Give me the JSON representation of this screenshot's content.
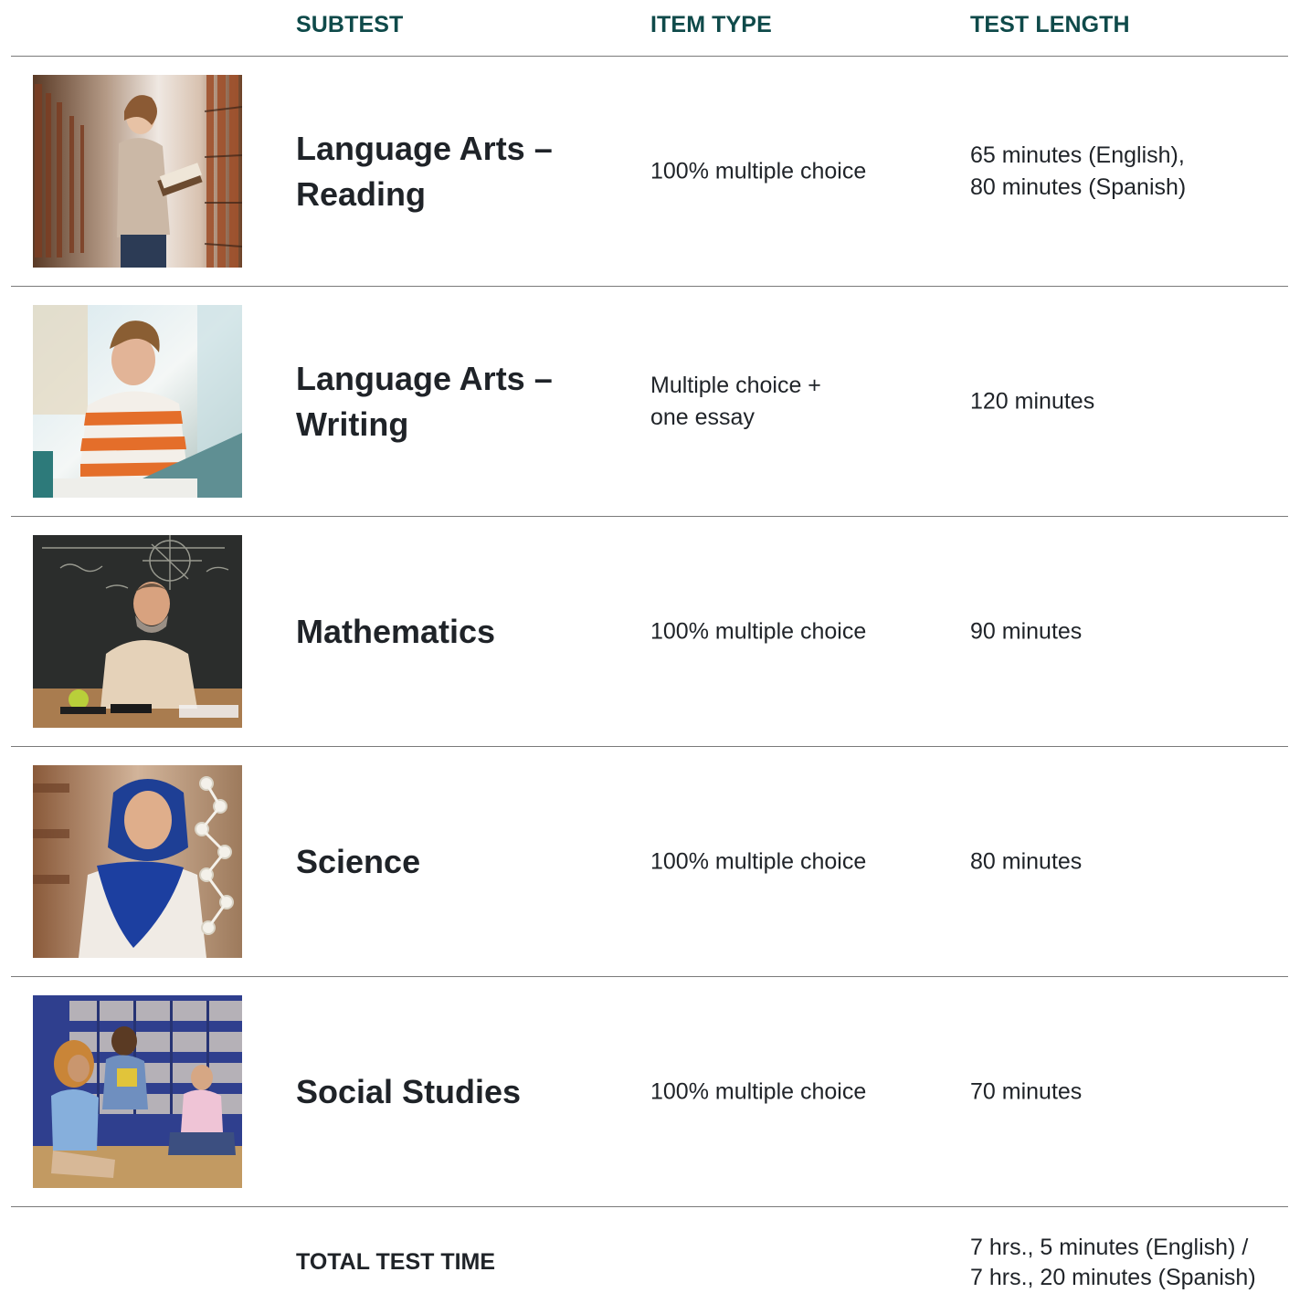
{
  "header": {
    "subtest": "SUBTEST",
    "item_type": "ITEM TYPE",
    "test_length": "TEST LENGTH"
  },
  "rows": [
    {
      "name_line1": "Language Arts –",
      "name_line2": "Reading",
      "item_type_line1": "100% multiple choice",
      "item_type_line2": "",
      "length_line1": "65 minutes (English),",
      "length_line2": "80 minutes (Spanish)",
      "photo": "woman-reading-in-library"
    },
    {
      "name_line1": "Language Arts –",
      "name_line2": "Writing",
      "item_type_line1": "Multiple choice +",
      "item_type_line2": "one essay",
      "length_line1": "120 minutes",
      "length_line2": "",
      "photo": "student-typing-on-laptop"
    },
    {
      "name_line1": "Mathematics",
      "name_line2": "",
      "item_type_line1": "100% multiple choice",
      "item_type_line2": "",
      "length_line1": "90 minutes",
      "length_line2": "",
      "photo": "teacher-at-chalkboard"
    },
    {
      "name_line1": "Science",
      "name_line2": "",
      "item_type_line1": "100% multiple choice",
      "item_type_line2": "",
      "length_line1": "80 minutes",
      "length_line2": "",
      "photo": "woman-with-dna-model"
    },
    {
      "name_line1": "Social Studies",
      "name_line2": "",
      "item_type_line1": "100% multiple choice",
      "item_type_line2": "",
      "length_line1": "70 minutes",
      "length_line2": "",
      "photo": "students-studying-in-library"
    }
  ],
  "total": {
    "label": "TOTAL TEST TIME",
    "value_line1": "7 hrs., 5 minutes (English) /",
    "value_line2": "7 hrs., 20 minutes (Spanish)"
  },
  "colors": {
    "header_text": "#0f4a4a",
    "body_text": "#1f2328",
    "divider": "#7a7a7a"
  }
}
